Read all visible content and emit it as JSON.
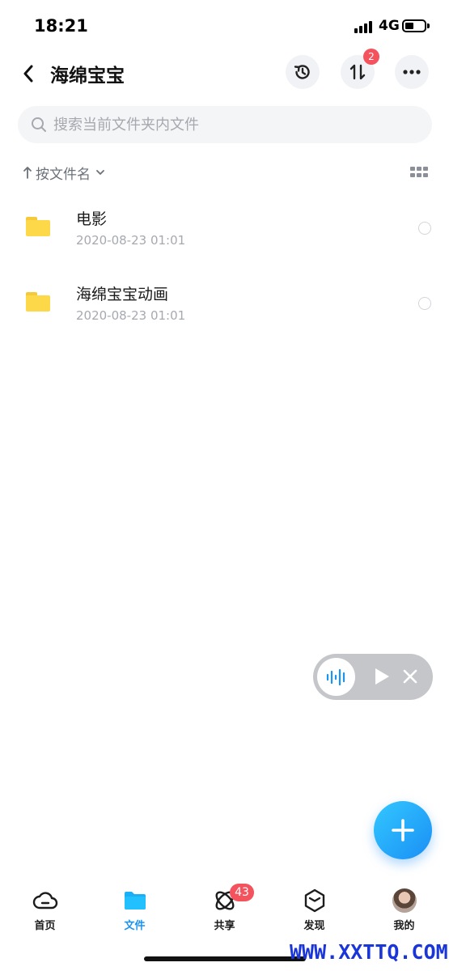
{
  "status_bar": {
    "time": "18:21",
    "network": "4G"
  },
  "header": {
    "title": "海绵宝宝",
    "transfer_badge": "2"
  },
  "search": {
    "placeholder": "搜索当前文件夹内文件"
  },
  "sort": {
    "label": "按文件名"
  },
  "files": [
    {
      "name": "电影",
      "date": "2020-08-23 01:01",
      "icon": "folder-icon"
    },
    {
      "name": "海绵宝宝动画",
      "date": "2020-08-23 01:01",
      "icon": "folder-icon"
    }
  ],
  "tabbar": {
    "items": [
      {
        "label": "首页",
        "icon": "cloud-icon",
        "active": false
      },
      {
        "label": "文件",
        "icon": "folder-icon",
        "active": true
      },
      {
        "label": "共享",
        "icon": "orbit-icon",
        "active": false,
        "badge": "43"
      },
      {
        "label": "发现",
        "icon": "hexagon-icon",
        "active": false
      },
      {
        "label": "我的",
        "icon": "avatar",
        "active": false
      }
    ]
  },
  "watermark": "WWW.XXTTQ.COM",
  "colors": {
    "accent": "#1b93f1",
    "badge": "#f4525c",
    "folder": "#fdd94a"
  }
}
